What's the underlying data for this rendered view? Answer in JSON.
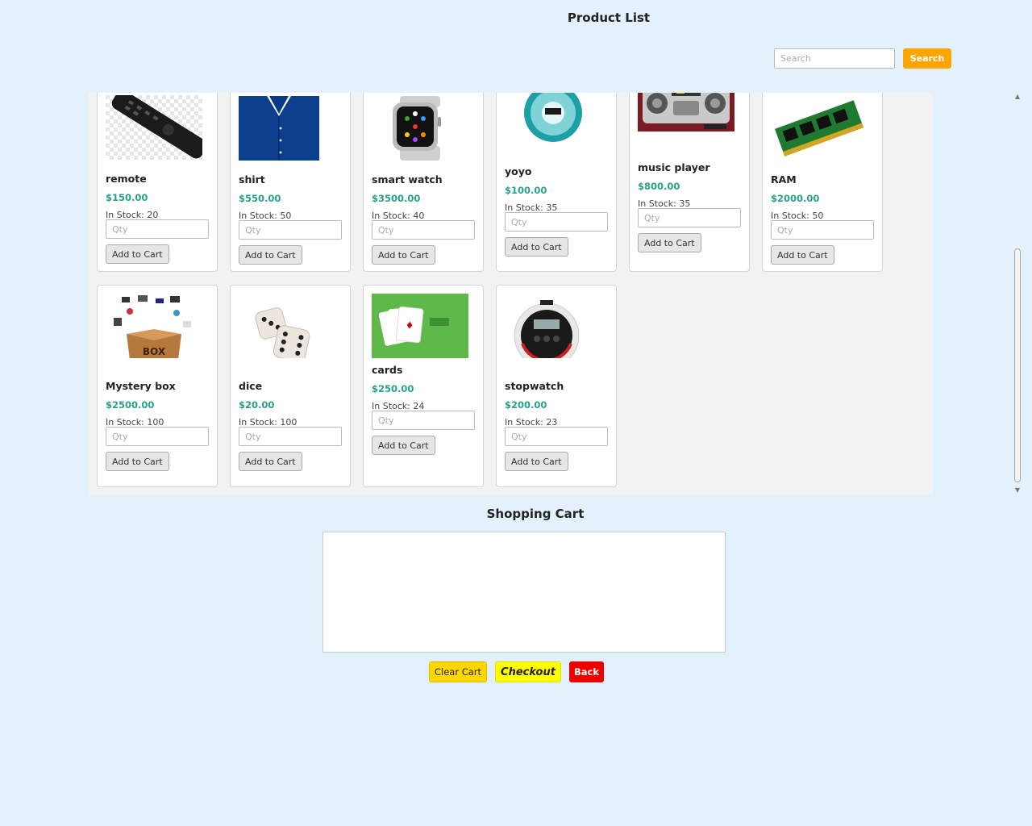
{
  "header": {
    "title": "Product List",
    "search_placeholder": "Search",
    "search_label": "Search"
  },
  "products": [
    {
      "name": "remote",
      "price": "$150.00",
      "stock": "In Stock: 20",
      "qty_placeholder": "Qty",
      "add_label": "Add to Cart",
      "image": "remote-image"
    },
    {
      "name": "shirt",
      "price": "$550.00",
      "stock": "In Stock: 50",
      "qty_placeholder": "Qty",
      "add_label": "Add to Cart",
      "image": "shirt-image"
    },
    {
      "name": "smart watch",
      "price": "$3500.00",
      "stock": "In Stock: 40",
      "qty_placeholder": "Qty",
      "add_label": "Add to Cart",
      "image": "smart-watch-image"
    },
    {
      "name": "yoyo",
      "price": "$100.00",
      "stock": "In Stock: 35",
      "qty_placeholder": "Qty",
      "add_label": "Add to Cart",
      "image": "yoyo-image"
    },
    {
      "name": "music player",
      "price": "$800.00",
      "stock": "In Stock: 35",
      "qty_placeholder": "Qty",
      "add_label": "Add to Cart",
      "image": "music-player-image"
    },
    {
      "name": "RAM",
      "price": "$2000.00",
      "stock": "In Stock: 50",
      "qty_placeholder": "Qty",
      "add_label": "Add to Cart",
      "image": "ram-image"
    },
    {
      "name": "Mystery box",
      "price": "$2500.00",
      "stock": "In Stock: 100",
      "qty_placeholder": "Qty",
      "add_label": "Add to Cart",
      "image": "mystery-box-image"
    },
    {
      "name": "dice",
      "price": "$20.00",
      "stock": "In Stock: 100",
      "qty_placeholder": "Qty",
      "add_label": "Add to Cart",
      "image": "dice-image"
    },
    {
      "name": "cards",
      "price": "$250.00",
      "stock": "In Stock: 24",
      "qty_placeholder": "Qty",
      "add_label": "Add to Cart",
      "image": "cards-image"
    },
    {
      "name": "stopwatch",
      "price": "$200.00",
      "stock": "In Stock: 23",
      "qty_placeholder": "Qty",
      "add_label": "Add to Cart",
      "image": "stopwatch-image"
    }
  ],
  "cart": {
    "title": "Shopping Cart",
    "clear_label": "Clear Cart",
    "checkout_label": "Checkout",
    "back_label": "Back"
  },
  "colors": {
    "background": "#e3f1fc",
    "search_button": "#ffa500",
    "price": "#27a08a",
    "clear_button": "#ffd700",
    "checkout_button": "#ffff00",
    "back_button": "#ee0000"
  }
}
